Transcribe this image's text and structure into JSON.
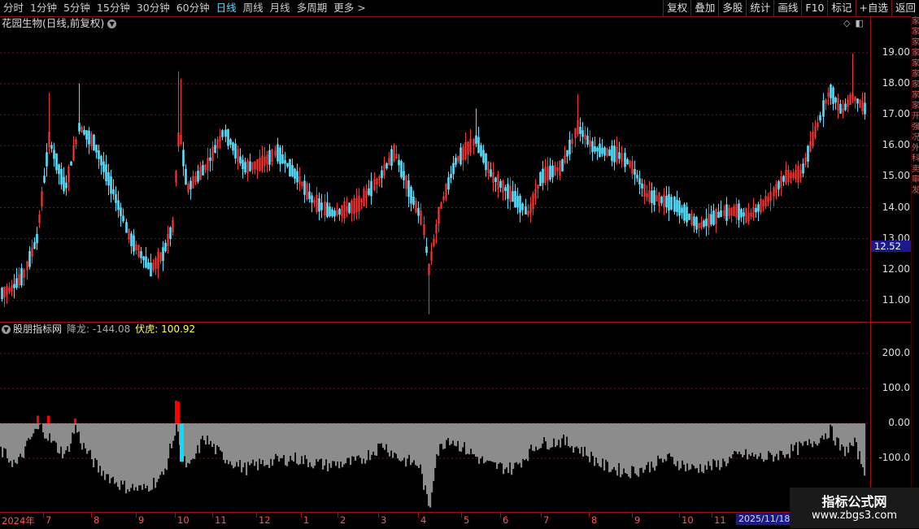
{
  "toolbar": {
    "periods": [
      {
        "label": "分时",
        "active": false
      },
      {
        "label": "1分钟",
        "active": false
      },
      {
        "label": "5分钟",
        "active": false
      },
      {
        "label": "15分钟",
        "active": false
      },
      {
        "label": "30分钟",
        "active": false
      },
      {
        "label": "60分钟",
        "active": false
      },
      {
        "label": "日线",
        "active": true
      },
      {
        "label": "周线",
        "active": false
      },
      {
        "label": "月线",
        "active": false
      },
      {
        "label": "多周期",
        "active": false
      },
      {
        "label": "更多",
        "active": false
      }
    ],
    "more_arrow": ">",
    "right_buttons": [
      "复权",
      "叠加",
      "多股",
      "统计",
      "画线",
      "F10",
      "标记",
      "+自选",
      "返回"
    ]
  },
  "chart_title": "花园生物(日线,前复权)",
  "price_axis": [
    "19.00",
    "18.00",
    "17.00",
    "16.00",
    "15.00",
    "14.00",
    "13.00",
    "12.00",
    "11.00"
  ],
  "current_price": "12.52",
  "indicator": {
    "name": "股朋指标网",
    "jl_label": "降龙:",
    "jl_value": "-144.08",
    "fh_label": "伏虎:",
    "fh_value": "100.92",
    "axis": [
      "200.0",
      "100.0",
      "0.00",
      "-100.0"
    ]
  },
  "x_axis": [
    "2024年",
    "7",
    "8",
    "9",
    "10",
    "11",
    "12",
    "1",
    "2",
    "3",
    "4",
    "5",
    "6",
    "7",
    "8",
    "9",
    "10",
    "11"
  ],
  "date_badge": "2025/11/18/",
  "side_text": [
    "家",
    "家",
    "家",
    "家",
    "家",
    "家",
    "家",
    "家",
    "家",
    "开",
    "强",
    "况",
    "外",
    "科",
    "卖",
    "审",
    "发"
  ],
  "watermark": {
    "title": "指标公式网",
    "url": "www.zbgs3.com"
  },
  "colors": {
    "up": "#ff3333",
    "down": "#55e0ff",
    "grid": "#8a1a1a",
    "area": "#8c8c8c",
    "fuhu": "#ff0000",
    "xianglong": "#00e0ff"
  }
}
